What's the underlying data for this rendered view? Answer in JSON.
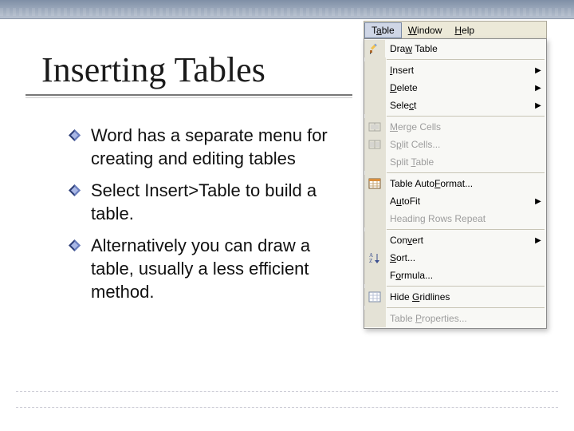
{
  "slide": {
    "title": "Inserting Tables",
    "bullets": [
      "Word has a separate menu for creating and editing tables",
      "Select Insert>Table to build a table.",
      "Alternatively you can draw a table, usually a less efficient method."
    ]
  },
  "menubar": {
    "items": [
      {
        "label": "Table",
        "mnemonic_index": 1,
        "active": true
      },
      {
        "label": "Window",
        "mnemonic_index": 0,
        "active": false
      },
      {
        "label": "Help",
        "mnemonic_index": 0,
        "active": false
      }
    ]
  },
  "menu": {
    "items": [
      {
        "icon": "pencil-icon",
        "label": "Draw Table",
        "mnemonic_index": 3,
        "submenu": false,
        "enabled": true
      },
      {
        "sep": true
      },
      {
        "icon": null,
        "label": "Insert",
        "mnemonic_index": 0,
        "submenu": true,
        "enabled": true
      },
      {
        "icon": null,
        "label": "Delete",
        "mnemonic_index": 0,
        "submenu": true,
        "enabled": true
      },
      {
        "icon": null,
        "label": "Select",
        "mnemonic_index": 4,
        "submenu": true,
        "enabled": true
      },
      {
        "sep": true
      },
      {
        "icon": "merge-cells-icon",
        "label": "Merge Cells",
        "mnemonic_index": 0,
        "submenu": false,
        "enabled": false
      },
      {
        "icon": "split-cells-icon",
        "label": "Split Cells...",
        "mnemonic_index": 1,
        "submenu": false,
        "enabled": false
      },
      {
        "icon": null,
        "label": "Split Table",
        "mnemonic_index": 6,
        "submenu": false,
        "enabled": false
      },
      {
        "sep": true
      },
      {
        "icon": "autoformat-icon",
        "label": "Table AutoFormat...",
        "mnemonic_index": 10,
        "submenu": false,
        "enabled": true
      },
      {
        "icon": null,
        "label": "AutoFit",
        "mnemonic_index": 1,
        "submenu": true,
        "enabled": true
      },
      {
        "icon": null,
        "label": "Heading Rows Repeat",
        "mnemonic_index": -1,
        "submenu": false,
        "enabled": false
      },
      {
        "sep": true
      },
      {
        "icon": null,
        "label": "Convert",
        "mnemonic_index": 3,
        "submenu": true,
        "enabled": true
      },
      {
        "icon": "sort-icon",
        "label": "Sort...",
        "mnemonic_index": 0,
        "submenu": false,
        "enabled": true
      },
      {
        "icon": null,
        "label": "Formula...",
        "mnemonic_index": 1,
        "submenu": false,
        "enabled": true
      },
      {
        "sep": true
      },
      {
        "icon": "gridlines-icon",
        "label": "Hide Gridlines",
        "mnemonic_index": 5,
        "submenu": false,
        "enabled": true
      },
      {
        "sep": true
      },
      {
        "icon": null,
        "label": "Table Properties...",
        "mnemonic_index": 6,
        "submenu": false,
        "enabled": false
      }
    ]
  },
  "icons": {
    "pencil-icon": "pencil",
    "merge-cells-icon": "merge",
    "split-cells-icon": "split",
    "autoformat-icon": "autoformat",
    "sort-icon": "sort",
    "gridlines-icon": "grid"
  }
}
